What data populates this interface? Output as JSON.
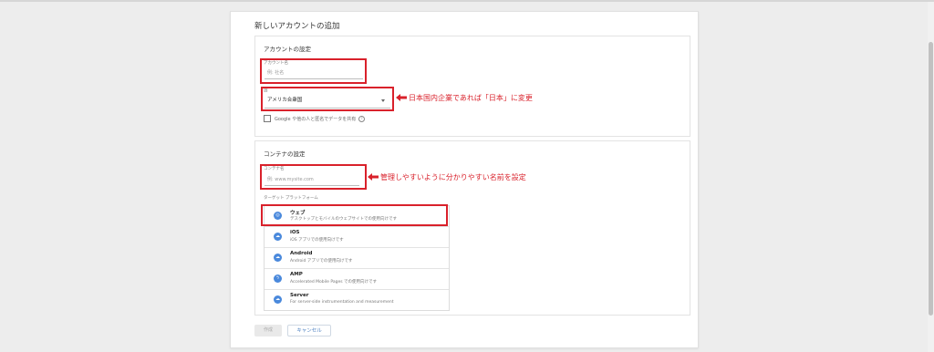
{
  "page": {
    "title": "新しいアカウントの追加"
  },
  "account_section": {
    "title": "アカウントの設定",
    "account_name_label": "アカウント名",
    "account_name_placeholder": "例: 社名",
    "country_label": "国",
    "country_value": "アメリカ合衆国",
    "share_checkbox_label": "Google や他の人と匿名でデータを共有",
    "annotation_country": "日本国内企業であれば「日本」に変更"
  },
  "container_section": {
    "title": "コンテナの設定",
    "container_name_label": "コンテナ名",
    "container_name_placeholder": "例: www.mysite.com",
    "annotation_container": "管理しやすいように分かりやすい名前を設定",
    "target_platform_label": "ターゲット プラットフォーム",
    "platforms": [
      {
        "name": "ウェブ",
        "desc": "デスクトップとモバイルのウェブサイトでの使用向けです",
        "icon": "globe-icon"
      },
      {
        "name": "iOS",
        "desc": "iOS アプリでの使用向けです",
        "icon": "cloud-icon"
      },
      {
        "name": "Android",
        "desc": "Android アプリでの使用向けです",
        "icon": "cloud-icon"
      },
      {
        "name": "AMP",
        "desc": "Accelerated Mobile Pages での使用向けです",
        "icon": "amp-bolt-icon"
      },
      {
        "name": "Server",
        "desc": "For server-side instrumentation and measurement",
        "icon": "cloud-icon"
      }
    ]
  },
  "buttons": {
    "create": "作成",
    "cancel": "キャンセル"
  },
  "colors": {
    "annotation_red": "#d9212b",
    "platform_blue": "#4a89dc",
    "cancel_blue": "#4a7fc1"
  }
}
